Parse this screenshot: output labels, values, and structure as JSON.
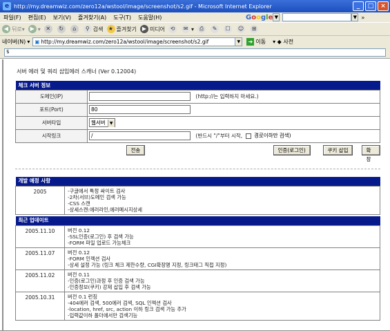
{
  "window": {
    "title": "http://my.dreamwiz.com/zero12a/wstool/image/screenshot/s2.gif - Microsoft Internet Explorer",
    "minimize": "_",
    "maximize": "□",
    "close": "×"
  },
  "menu": {
    "items": [
      "파일(F)",
      "편집(E)",
      "보기(V)",
      "즐겨찾기(A)",
      "도구(T)",
      "도움말(H)"
    ],
    "google": "Google",
    "more": "»"
  },
  "toolbar": {
    "back": "뒤로",
    "search": "검색",
    "favorites": "즐겨찾기",
    "media": "미디어"
  },
  "address": {
    "label": "네이버(N)",
    "url": "http://my.dreamwiz.com/zero12a/wstool/image/screenshot/s2.gif",
    "go": "이동",
    "links": "사전"
  },
  "page": {
    "title": "서버 에러 및 쿼리 삽입에러 스캐너 (Ver 0.12004)",
    "check": {
      "header": "체크 서버 정보",
      "domain_label": "도메인(IP)",
      "domain_value": "",
      "domain_hint": "(http://는 입력하지 마세요.)",
      "port_label": "포트(Port)",
      "port_value": "80",
      "server_type_label": "서버타입",
      "server_type_value": "웹서버",
      "start_link_label": "시작링크",
      "start_link_value": "/",
      "start_link_hint": "(반드시 \"/\"부터 시작,",
      "below_only_label": "경로이하만 검색)",
      "submit_label": "전송",
      "auth_label": "인증(로그인)",
      "cookie_label": "쿠키 삽입",
      "extend_label": "확장"
    },
    "plan": {
      "header": "개발 예정 사항",
      "rows": [
        {
          "date": "2005",
          "lines": [
            "-구글에서 특정 싸이트 검사",
            "-2차(서브)도메인 검색 가능",
            "-CSS 스캔",
            "-상세스캔:에러라인,에러메시지상세"
          ]
        }
      ]
    },
    "updates": {
      "header": "최근 업데이트",
      "rows": [
        {
          "date": "2005.11.10",
          "lines": [
            "버전 0.12",
            "-SSL인증(로그인) 후 검색 가능",
            "-FORM 파일 업로드 가능체크"
          ]
        },
        {
          "date": "2005.11.07",
          "lines": [
            "버전 0.12",
            "-FORM 인젝션 검사",
            "-상세 설정 가능 (링크 체크 제한수량, CGI확장명 지정, 링크태그 직접 지정)"
          ]
        },
        {
          "date": "2005.11.02",
          "lines": [
            "버전 0.11",
            "-인증(로그인)과정 후 인증 검색 가능",
            "-인증정보(쿠키) 강제 삽입 후 검색 가능"
          ]
        },
        {
          "date": "2005.10.31",
          "lines": [
            "버전 0.1 런칭",
            "-404에러 검색, 500에러 검색, SQL 인젝션 검사",
            "-location, href, src, action 이하 링크 검색 가능 추가",
            "-입력값이하 폴더에서만 검색기능"
          ]
        }
      ]
    }
  }
}
